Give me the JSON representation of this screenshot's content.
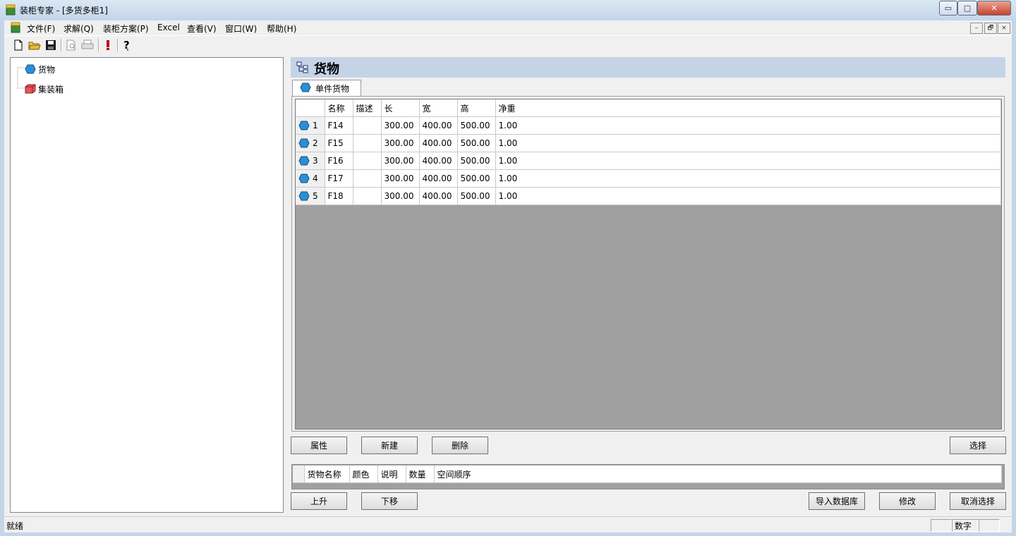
{
  "window": {
    "title": "装柜专家 - [多货多柜1]"
  },
  "caption_buttons": {
    "minimize": "▭",
    "maximize": "□",
    "close": "✕"
  },
  "menu": {
    "items": [
      "文件(F)",
      "求解(Q)",
      "装柜方案(P)",
      "Excel",
      "查看(V)",
      "窗口(W)",
      "帮助(H)"
    ],
    "mdi_buttons": [
      "–",
      "🗗",
      "×"
    ]
  },
  "toolbar": {
    "icons": [
      "new-file-icon",
      "open-folder-icon",
      "save-icon",
      "print-preview-icon",
      "print-icon",
      "exclamation-icon",
      "help-icon"
    ]
  },
  "tree": {
    "nodes": [
      {
        "label": "货物",
        "icon": "cargo-icon"
      },
      {
        "label": "集装箱",
        "icon": "container-icon"
      }
    ]
  },
  "panel": {
    "title": "货物",
    "tab": "单件货物",
    "columns": [
      "名称",
      "描述",
      "长",
      "宽",
      "高",
      "净重"
    ],
    "rows": [
      {
        "num": "1",
        "name": "F14",
        "desc": "",
        "length": "300.00",
        "width": "400.00",
        "height": "500.00",
        "weight": "1.00"
      },
      {
        "num": "2",
        "name": "F15",
        "desc": "",
        "length": "300.00",
        "width": "400.00",
        "height": "500.00",
        "weight": "1.00"
      },
      {
        "num": "3",
        "name": "F16",
        "desc": "",
        "length": "300.00",
        "width": "400.00",
        "height": "500.00",
        "weight": "1.00"
      },
      {
        "num": "4",
        "name": "F17",
        "desc": "",
        "length": "300.00",
        "width": "400.00",
        "height": "500.00",
        "weight": "1.00"
      },
      {
        "num": "5",
        "name": "F18",
        "desc": "",
        "length": "300.00",
        "width": "400.00",
        "height": "500.00",
        "weight": "1.00"
      }
    ],
    "buttons": {
      "properties": "属性",
      "new": "新建",
      "delete": "删除",
      "select": "选择"
    }
  },
  "selection": {
    "columns": [
      "货物名称",
      "颜色",
      "说明",
      "数量",
      "空间顺序"
    ],
    "buttons": {
      "up": "上升",
      "down": "下移",
      "import": "导入数据库",
      "modify": "修改",
      "cancel": "取消选择"
    }
  },
  "status": {
    "text": "就绪",
    "indicator": "数字"
  },
  "colors": {
    "titlebar": "#c3d5ea",
    "grid_empty": "#a0a0a0",
    "panel_header": "#c4d3e6"
  }
}
